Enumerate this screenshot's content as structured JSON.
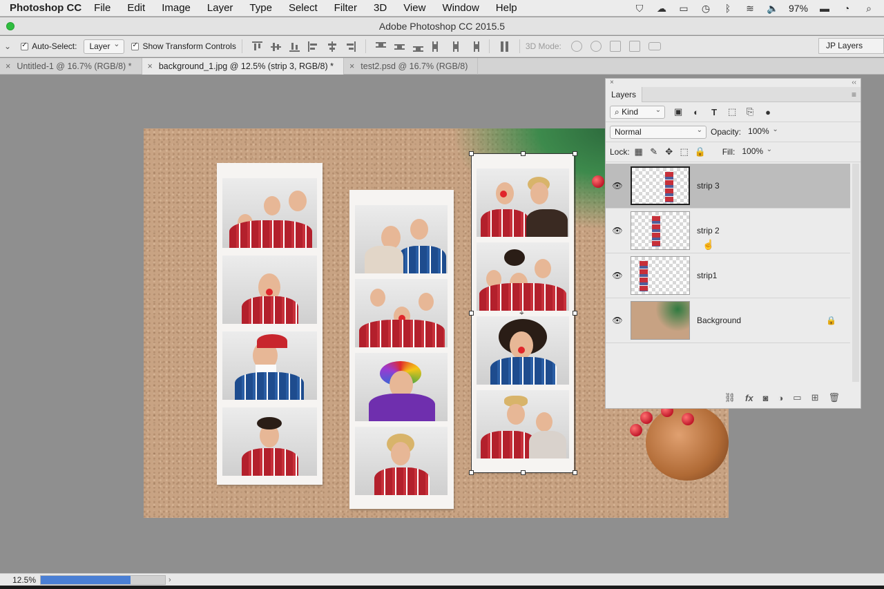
{
  "menubar": {
    "app_name": "Photoshop CC",
    "items": [
      "File",
      "Edit",
      "Image",
      "Layer",
      "Type",
      "Select",
      "Filter",
      "3D",
      "View",
      "Window",
      "Help"
    ],
    "battery": "97%"
  },
  "window": {
    "title": "Adobe Photoshop CC 2015.5"
  },
  "options": {
    "auto_select_label": "Auto-Select:",
    "auto_select_value": "Layer",
    "show_transform_label": "Show Transform Controls",
    "mode_3d_label": "3D Mode:",
    "workspace": "JP Layers"
  },
  "tabs": [
    {
      "label": "Untitled-1 @ 16.7% (RGB/8) *",
      "active": false
    },
    {
      "label": "background_1.jpg @ 12.5% (strip 3, RGB/8) *",
      "active": true
    },
    {
      "label": "test2.psd @ 16.7% (RGB/8)",
      "active": false
    }
  ],
  "layers_panel": {
    "tab_label": "Layers",
    "filter_kind": "Kind",
    "blend_mode": "Normal",
    "opacity_label": "Opacity:",
    "opacity_value": "100%",
    "lock_label": "Lock:",
    "fill_label": "Fill:",
    "fill_value": "100%",
    "layers": [
      {
        "name": "strip 3",
        "selected": true,
        "visible": true,
        "locked": false
      },
      {
        "name": "strip 2",
        "selected": false,
        "visible": true,
        "locked": false
      },
      {
        "name": "strip1",
        "selected": false,
        "visible": true,
        "locked": false
      },
      {
        "name": "Background",
        "selected": false,
        "visible": true,
        "locked": true
      }
    ]
  },
  "status": {
    "zoom": "12.5%",
    "progress": 0.72
  },
  "colors": {
    "accent": "#4a7fd4",
    "selected_layer": "#bcbcbc"
  }
}
